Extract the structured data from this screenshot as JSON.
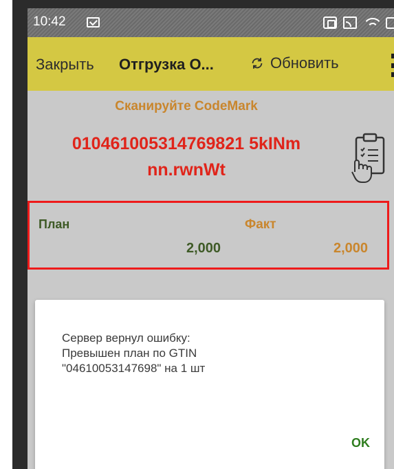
{
  "status_bar": {
    "time": "10:42",
    "icons": [
      "mail-check-icon",
      "nfc-icon",
      "cast-icon",
      "wifi-icon",
      "battery-icon"
    ]
  },
  "toolbar": {
    "close_label": "Закрыть",
    "title": "Отгрузка О...",
    "refresh_label": "Обновить",
    "background_color": "#d4c843"
  },
  "scan": {
    "prompt": "Сканируйте CodeMark",
    "code_line1": "010461005314769821 5kINm",
    "code_line2": "nn.rwnWt"
  },
  "quantities": {
    "plan_label": "План",
    "fact_label": "Факт",
    "plan_value": "2,000",
    "fact_value": "2,000"
  },
  "dialog": {
    "message": "Сервер вернул ошибку:\nПревышен план по GTIN\n\"04610053147698\" на 1 шт",
    "ok_label": "OK"
  },
  "colors": {
    "accent_orange": "#c9862d",
    "code_red": "#e0241a",
    "plan_green": "#3e5a26",
    "highlight_border": "#ee1a1a",
    "ok_green": "#2e7d1e"
  }
}
